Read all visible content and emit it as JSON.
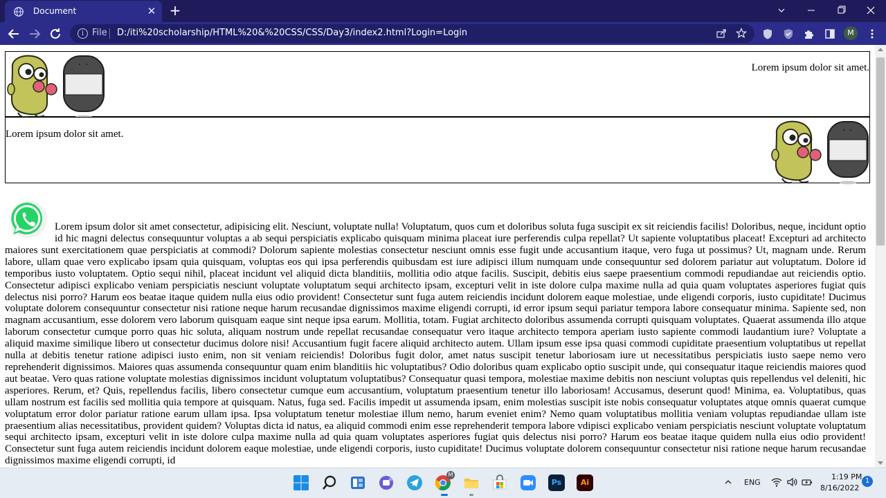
{
  "browser": {
    "tab_title": "Document",
    "tab_close": "✕",
    "new_tab": "+",
    "scheme": "File",
    "url": "D:/iti%20scholarship/HTML%20&%20CSS/CSS/Day3/index2.html?Login=Login",
    "profile_initial": "M",
    "icons": [
      "globe-icon",
      "close-icon",
      "plus-icon",
      "chevron-down-icon",
      "minimize-icon",
      "maximize-icon",
      "close-window-icon",
      "back-arrow-icon",
      "forward-arrow-icon",
      "reload-icon",
      "info-icon",
      "share-icon",
      "star-icon",
      "shield-icon",
      "extension-icon",
      "puzzle-icon",
      "side-panel-icon",
      "menu-dots-icon"
    ]
  },
  "page": {
    "box1_text": "Lorem ipsum dolor sit amet.",
    "box2_text": "Lorem ipsum dolor sit amet.",
    "article_text": "Lorem ipsum dolor sit amet consectetur, adipisicing elit. Nesciunt, voluptate nulla! Voluptatum, quos cum et doloribus soluta fuga suscipit ex sit reiciendis facilis! Doloribus, neque, incidunt optio id hic magni delectus consequuntur voluptas a ab sequi perspiciatis explicabo quisquam minima placeat iure perferendis culpa repellat? Ut sapiente voluptatibus placeat! Excepturi ad architecto maiores sunt exercitationem quae perspiciatis at commodi? Dolorum sapiente molestias consectetur nesciunt omnis esse fugit unde accusantium itaque, vero fuga ut possimus? Ut, magnam unde. Rerum labore, ullam quae vero explicabo ipsam quia quisquam, voluptas eos qui ipsa perferendis quibusdam est iure adipisci illum numquam unde consequuntur sed dolorem pariatur aut voluptatum. Dolore id temporibus iusto voluptatem. Optio sequi nihil, placeat incidunt vel aliquid dicta blanditiis, mollitia odio atque facilis. Suscipit, debitis eius saepe praesentium commodi repudiandae aut reiciendis optio. Consectetur adipisci explicabo veniam perspiciatis nesciunt voluptate voluptatum sequi architecto ipsam, excepturi velit in iste dolore culpa maxime nulla ad quia quam voluptates asperiores fugiat quis delectus nisi porro? Harum eos beatae itaque quidem nulla eius odio provident! Consectetur sunt fuga autem reiciendis incidunt dolorem eaque molestiae, unde eligendi corporis, iusto cupiditate! Ducimus voluptate dolorem consequuntur consectetur nisi ratione neque harum recusandae dignissimos maxime eligendi corrupti, id error ipsum sequi pariatur tempora labore consequatur minima. Sapiente sed, non magnam accusantium, esse dolorem vero laborum quisquam eaque sint neque ipsa earum. Mollitia, totam. Fugiat architecto doloribus assumenda corrupti quisquam voluptates. Quaerat assumenda illo atque laborum consectetur cumque porro quas hic soluta, aliquam nostrum unde repellat recusandae consequatur vero itaque architecto tempora aperiam iusto sapiente commodi laudantium iure? Voluptate a aliquid maxime similique libero ut consectetur ducimus dolore nisi! Accusantium fugit facere aliquid architecto autem. Ullam ipsum esse ipsa quasi commodi cupiditate praesentium voluptatibus ut repellat nulla at debitis tenetur ratione adipisci iusto enim, non sit veniam reiciendis! Doloribus fugit dolor, amet natus suscipit tenetur laboriosam iure ut necessitatibus perspiciatis iusto saepe nemo vero reprehenderit dignissimos. Maiores quas assumenda consequuntur quam enim blanditiis hic voluptatibus? Odio doloribus quam explicabo optio suscipit unde, qui consequatur itaque reiciendis maiores quod aut beatae. Vero quas ratione voluptate molestias dignissimos incidunt voluptatum voluptatibus? Consequatur quasi tempora, molestiae maxime debitis non nesciunt voluptas quis repellendus vel deleniti, hic asperiores. Rerum, et? Quis, repellendus facilis, libero consectetur cumque eum accusantium, voluptatum praesentium tenetur illo laboriosam! Accusamus, deserunt quod! Minima, ea. Voluptatibus, quas ullam nostrum est facilis sed mollitia quia tempore at quisquam. Natus, fuga sed. Facilis impedit ut assumenda ipsam, enim molestias suscipit iste nobis consequatur voluptates atque omnis quaerat cumque voluptatum error dolor pariatur ratione earum ullam ipsa. Ipsa voluptatum tenetur molestiae illum nemo, harum eveniet enim? Nemo quam voluptatibus mollitia veniam voluptas repudiandae ullam iste praesentium alias necessitatibus, provident quidem? Voluptas dicta id natus, ea aliquid commodi enim esse reprehenderit tempora labore vdipisci explicabo veniam perspiciatis nesciunt voluptate voluptatum sequi architecto ipsam, excepturi velit in iste dolore culpa maxime nulla ad quia quam voluptates asperiores fugiat quis delectus nisi porro? Harum eos beatae itaque quidem nulla eius odio provident! Consectetur sunt fuga autem reiciendis incidunt dolorem eaque molestiae, unde eligendi corporis, iusto cupiditate! Ducimus voluptate dolorem consequuntur consectetur nisi ratione neque harum recusandae dignissimos maxime eligendi corrupti, id"
  },
  "taskbar": {
    "apps": [
      "windows-start-icon",
      "search-icon",
      "widgets-icon",
      "teams-icon",
      "telegram-icon",
      "chrome-icon",
      "file-explorer-icon",
      "microsoft-store-icon",
      "zoom-icon",
      "photoshop-icon",
      "illustrator-icon"
    ],
    "ps_label": "Ps",
    "ai_label": "Ai",
    "chrome_badge": "M",
    "language": "ENG",
    "time": "1:19 PM",
    "date": "8/16/2022",
    "notifications": "1"
  },
  "colors": {
    "titlebar": "#1f1b5b",
    "toolbar": "#2c2d8a",
    "omnibox": "#1e1f66",
    "whatsapp": "#25d366",
    "gopher_green": "#c2c35a"
  }
}
